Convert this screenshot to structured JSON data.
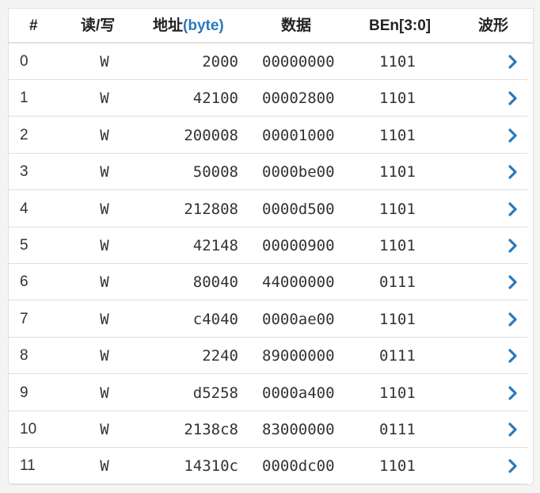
{
  "header": {
    "index": "#",
    "rw": "读/写",
    "address_prefix": "地址",
    "address_unit": "(byte)",
    "data": "数据",
    "ben": "BEn[3:0]",
    "wave": "波形"
  },
  "rows": [
    {
      "index": "0",
      "rw": "W",
      "address": "2000",
      "data": "00000000",
      "ben": "1101"
    },
    {
      "index": "1",
      "rw": "W",
      "address": "42100",
      "data": "00002800",
      "ben": "1101"
    },
    {
      "index": "2",
      "rw": "W",
      "address": "200008",
      "data": "00001000",
      "ben": "1101"
    },
    {
      "index": "3",
      "rw": "W",
      "address": "50008",
      "data": "0000be00",
      "ben": "1101"
    },
    {
      "index": "4",
      "rw": "W",
      "address": "212808",
      "data": "0000d500",
      "ben": "1101"
    },
    {
      "index": "5",
      "rw": "W",
      "address": "42148",
      "data": "00000900",
      "ben": "1101"
    },
    {
      "index": "6",
      "rw": "W",
      "address": "80040",
      "data": "44000000",
      "ben": "0111"
    },
    {
      "index": "7",
      "rw": "W",
      "address": "c4040",
      "data": "0000ae00",
      "ben": "1101"
    },
    {
      "index": "8",
      "rw": "W",
      "address": "2240",
      "data": "89000000",
      "ben": "0111"
    },
    {
      "index": "9",
      "rw": "W",
      "address": "d5258",
      "data": "0000a400",
      "ben": "1101"
    },
    {
      "index": "10",
      "rw": "W",
      "address": "2138c8",
      "data": "83000000",
      "ben": "0111"
    },
    {
      "index": "11",
      "rw": "W",
      "address": "14310c",
      "data": "0000dc00",
      "ben": "1101"
    }
  ],
  "wave_icon": "chevron-right-icon",
  "colors": {
    "accent": "#2a79bd",
    "text": "#333333",
    "border": "#dedede"
  }
}
